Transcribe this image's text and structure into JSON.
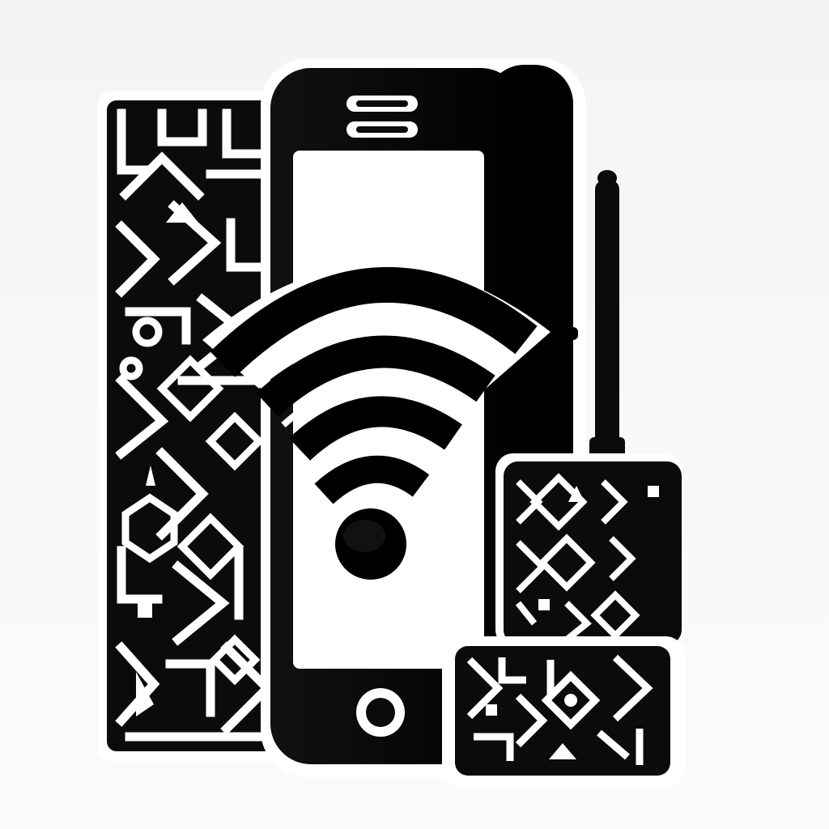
{
  "scene": {
    "background": "#f7f7f7",
    "ink": "#0b0b0b",
    "paper": "#ffffff",
    "objects": [
      "qr-pattern-panel",
      "smartphone-icon",
      "wifi-signal-icon",
      "wireless-router-device",
      "antenna",
      "qr-pattern-tile"
    ]
  }
}
